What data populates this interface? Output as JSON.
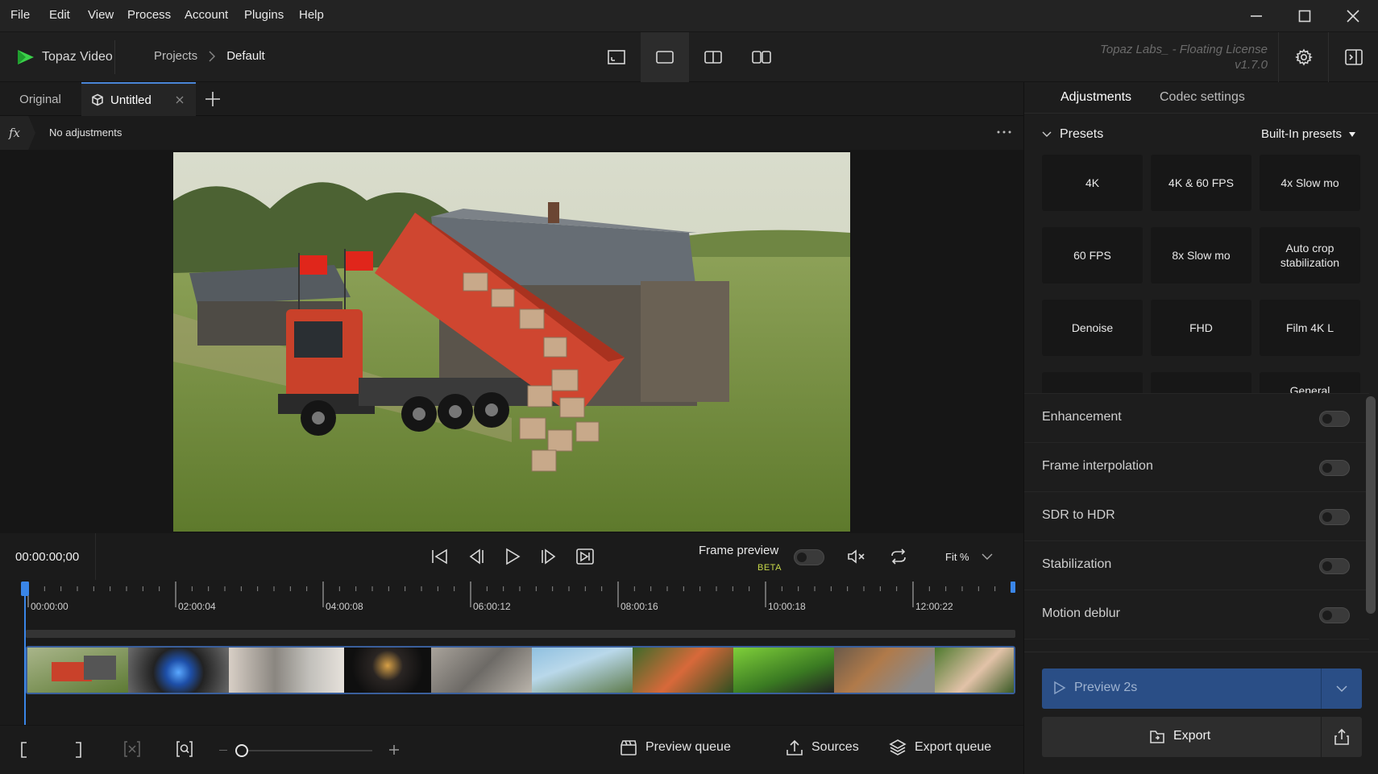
{
  "menu": [
    "File",
    "Edit",
    "View",
    "Process",
    "Account",
    "Plugins",
    "Help"
  ],
  "header": {
    "brand": "Topaz Video",
    "breadcrumb": {
      "root": "Projects",
      "current": "Default"
    },
    "license": "Topaz Labs_ - Floating License",
    "version": "v1.7.0"
  },
  "tabs": {
    "original": "Original",
    "untitled": "Untitled"
  },
  "adjustments_bar": {
    "fx_label": "fx",
    "status": "No adjustments"
  },
  "transport": {
    "timecode": "00:00:00;00",
    "frame_preview": "Frame preview",
    "beta": "BETA",
    "fit": "Fit %"
  },
  "timeline": {
    "ticks": [
      "00:00:00",
      "02:00:04",
      "04:00:08",
      "06:00:12",
      "08:00:16",
      "10:00:18",
      "12:00:22"
    ]
  },
  "bottombar": {
    "preview_queue": "Preview queue",
    "sources": "Sources",
    "export_queue": "Export queue"
  },
  "panel": {
    "tabs": {
      "adjustments": "Adjustments",
      "codec": "Codec settings"
    },
    "presets_label": "Presets",
    "presets_dropdown": "Built-In presets",
    "presets": [
      "4K",
      "4K & 60 FPS",
      "4x Slow mo",
      "60 FPS",
      "8x Slow mo",
      "Auto crop stabilization",
      "Denoise",
      "FHD",
      "Film 4K L",
      "",
      "",
      "General"
    ],
    "toggles": [
      "Enhancement",
      "Frame interpolation",
      "SDR to HDR",
      "Stabilization",
      "Motion deblur"
    ],
    "preview_button": "Preview 2s",
    "export_button": "Export"
  },
  "colors": {
    "accent": "#2f5c9c",
    "beta": "#c8d94a",
    "playhead": "#3a86e8"
  }
}
